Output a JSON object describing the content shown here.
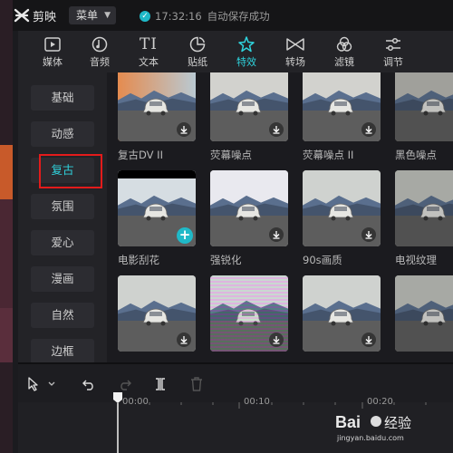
{
  "app": {
    "name": "剪映",
    "menu_label": "菜单",
    "save_time": "17:32:16",
    "save_status": "自动保存成功"
  },
  "toolbar": {
    "tabs": [
      {
        "label": "媒体",
        "icon": "media-icon"
      },
      {
        "label": "音频",
        "icon": "audio-icon"
      },
      {
        "label": "文本",
        "icon": "text-icon"
      },
      {
        "label": "贴纸",
        "icon": "sticker-icon"
      },
      {
        "label": "特效",
        "icon": "effects-icon",
        "active": true
      },
      {
        "label": "转场",
        "icon": "transition-icon"
      },
      {
        "label": "滤镜",
        "icon": "filter-icon"
      },
      {
        "label": "调节",
        "icon": "adjust-icon"
      }
    ]
  },
  "categories": [
    "基础",
    "动感",
    "复古",
    "氛围",
    "爱心",
    "漫画",
    "自然",
    "边框"
  ],
  "active_category": "复古",
  "effects": [
    {
      "label": "复古DV II",
      "variant": "dv",
      "action": "download"
    },
    {
      "label": "荧幕噪点",
      "variant": "noise",
      "action": "download"
    },
    {
      "label": "荧幕噪点 II",
      "variant": "noise",
      "action": "download"
    },
    {
      "label": "黑色噪点",
      "variant": "dark",
      "action": "download"
    },
    {
      "label": "电影刮花",
      "variant": "letterbox",
      "action": "add"
    },
    {
      "label": "强锐化",
      "variant": "sharpen",
      "action": "download"
    },
    {
      "label": "90s画质",
      "variant": "faded",
      "action": "download"
    },
    {
      "label": "电视纹理",
      "variant": "tv",
      "action": "download"
    },
    {
      "label": "",
      "variant": "faded",
      "action": "download"
    },
    {
      "label": "",
      "variant": "glitch",
      "action": "download"
    },
    {
      "label": "",
      "variant": "faded",
      "action": "download"
    },
    {
      "label": "",
      "variant": "tv",
      "action": "download"
    }
  ],
  "timeline": {
    "ticks": [
      "00:00",
      "00:10",
      "00:20"
    ]
  },
  "colors": {
    "accent": "#2fd3dd",
    "highlight_box": "#e31b1b",
    "add_button": "#1fb9c8"
  },
  "watermark": {
    "text": "Bai 经验",
    "subtext": "jingyan.baidu.com"
  }
}
